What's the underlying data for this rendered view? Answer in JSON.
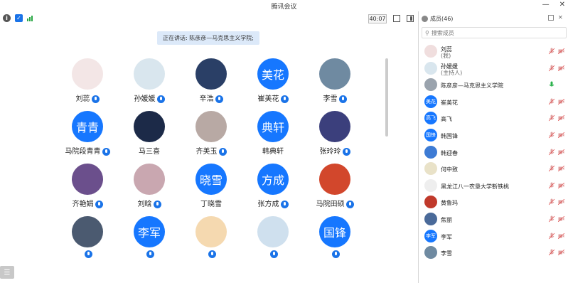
{
  "window": {
    "title": "腾讯会议"
  },
  "toolbar": {
    "timer": "40:07"
  },
  "main": {
    "speaking": "正在讲话: 陈彦彦—马克思主义学院;",
    "tiles": [
      {
        "name": "刘蕊",
        "mic": true,
        "avatar": "photo",
        "color": "#f3e6e6"
      },
      {
        "name": "孙媛媛",
        "mic": true,
        "avatar": "photo",
        "color": "#d9e6ee"
      },
      {
        "name": "辛浩",
        "mic": true,
        "avatar": "photo",
        "color": "#2a3f66"
      },
      {
        "name": "崔美花",
        "mic": true,
        "avatar": "text",
        "text": "美花",
        "color": "#1677ff"
      },
      {
        "name": "李雪",
        "mic": true,
        "avatar": "photo",
        "color": "#6f8aa1"
      },
      {
        "name": "马院段青青",
        "mic": true,
        "avatar": "text",
        "text": "青青",
        "color": "#1677ff"
      },
      {
        "name": "马三喜",
        "mic": false,
        "avatar": "photo",
        "color": "#1c2a48"
      },
      {
        "name": "齐美玉",
        "mic": true,
        "avatar": "photo",
        "color": "#b8a9a4"
      },
      {
        "name": "韩典轩",
        "mic": false,
        "avatar": "text",
        "text": "典轩",
        "color": "#1677ff"
      },
      {
        "name": "张玲玲",
        "mic": true,
        "avatar": "photo",
        "color": "#3b3f7c"
      },
      {
        "name": "齐艳娟",
        "mic": true,
        "avatar": "photo",
        "color": "#6b4f8c"
      },
      {
        "name": "刘晗",
        "mic": true,
        "avatar": "photo",
        "color": "#c9a7b0"
      },
      {
        "name": "丁晓雪",
        "mic": false,
        "avatar": "text",
        "text": "晓雪",
        "color": "#1677ff"
      },
      {
        "name": "张方成",
        "mic": true,
        "avatar": "text",
        "text": "方成",
        "color": "#1677ff"
      },
      {
        "name": "马院田硕",
        "mic": true,
        "avatar": "photo",
        "color": "#d2472c"
      },
      {
        "name": "",
        "mic": true,
        "avatar": "photo",
        "color": "#4b5a70"
      },
      {
        "name": "",
        "mic": true,
        "avatar": "text",
        "text": "李军",
        "color": "#1677ff"
      },
      {
        "name": "",
        "mic": true,
        "avatar": "photo",
        "color": "#f5d9b0"
      },
      {
        "name": "",
        "mic": true,
        "avatar": "photo",
        "color": "#cfe0ee"
      },
      {
        "name": "",
        "mic": true,
        "avatar": "text",
        "text": "国锋",
        "color": "#1677ff"
      }
    ]
  },
  "panel": {
    "title": "成员(46)",
    "search_placeholder": "搜索成员",
    "members": [
      {
        "name": "刘蕊",
        "role": "(我)",
        "av": "photo",
        "color": "#f0dede",
        "mic": "muted",
        "cam": "off"
      },
      {
        "name": "孙媛媛",
        "role": "(主持人)",
        "av": "photo",
        "color": "#d9e6ee",
        "mic": "muted",
        "cam": "off"
      },
      {
        "name": "陈彦彦—马克思主义学院",
        "role": "",
        "av": "photo",
        "color": "#9aa3ad",
        "mic": "on",
        "cam": "none"
      },
      {
        "name": "崔美花",
        "role": "",
        "av": "text",
        "text": "美花",
        "color": "#1677ff",
        "mic": "muted",
        "cam": "off"
      },
      {
        "name": "高飞",
        "role": "",
        "av": "text",
        "text": "高飞",
        "color": "#1677ff",
        "mic": "muted",
        "cam": "off"
      },
      {
        "name": "韩国锋",
        "role": "",
        "av": "text",
        "text": "国锋",
        "color": "#1677ff",
        "mic": "muted",
        "cam": "off"
      },
      {
        "name": "韩迎春",
        "role": "",
        "av": "photo",
        "color": "#3d7bd4",
        "mic": "muted",
        "cam": "off"
      },
      {
        "name": "何中致",
        "role": "",
        "av": "photo",
        "color": "#e9e2c8",
        "mic": "muted",
        "cam": "off"
      },
      {
        "name": "黑龙江八一农垦大学靳铁桃",
        "role": "",
        "av": "photo",
        "color": "#eee",
        "mic": "muted",
        "cam": "off"
      },
      {
        "name": "黄鲁玛",
        "role": "",
        "av": "photo",
        "color": "#c0392b",
        "mic": "muted",
        "cam": "off"
      },
      {
        "name": "焦丽",
        "role": "",
        "av": "photo",
        "color": "#4a6a99",
        "mic": "muted",
        "cam": "off"
      },
      {
        "name": "李军",
        "role": "",
        "av": "text",
        "text": "李军",
        "color": "#1677ff",
        "mic": "muted",
        "cam": "off"
      },
      {
        "name": "李雪",
        "role": "",
        "av": "photo",
        "color": "#6f8aa1",
        "mic": "muted",
        "cam": "off"
      }
    ]
  },
  "main_list_button": "☰"
}
